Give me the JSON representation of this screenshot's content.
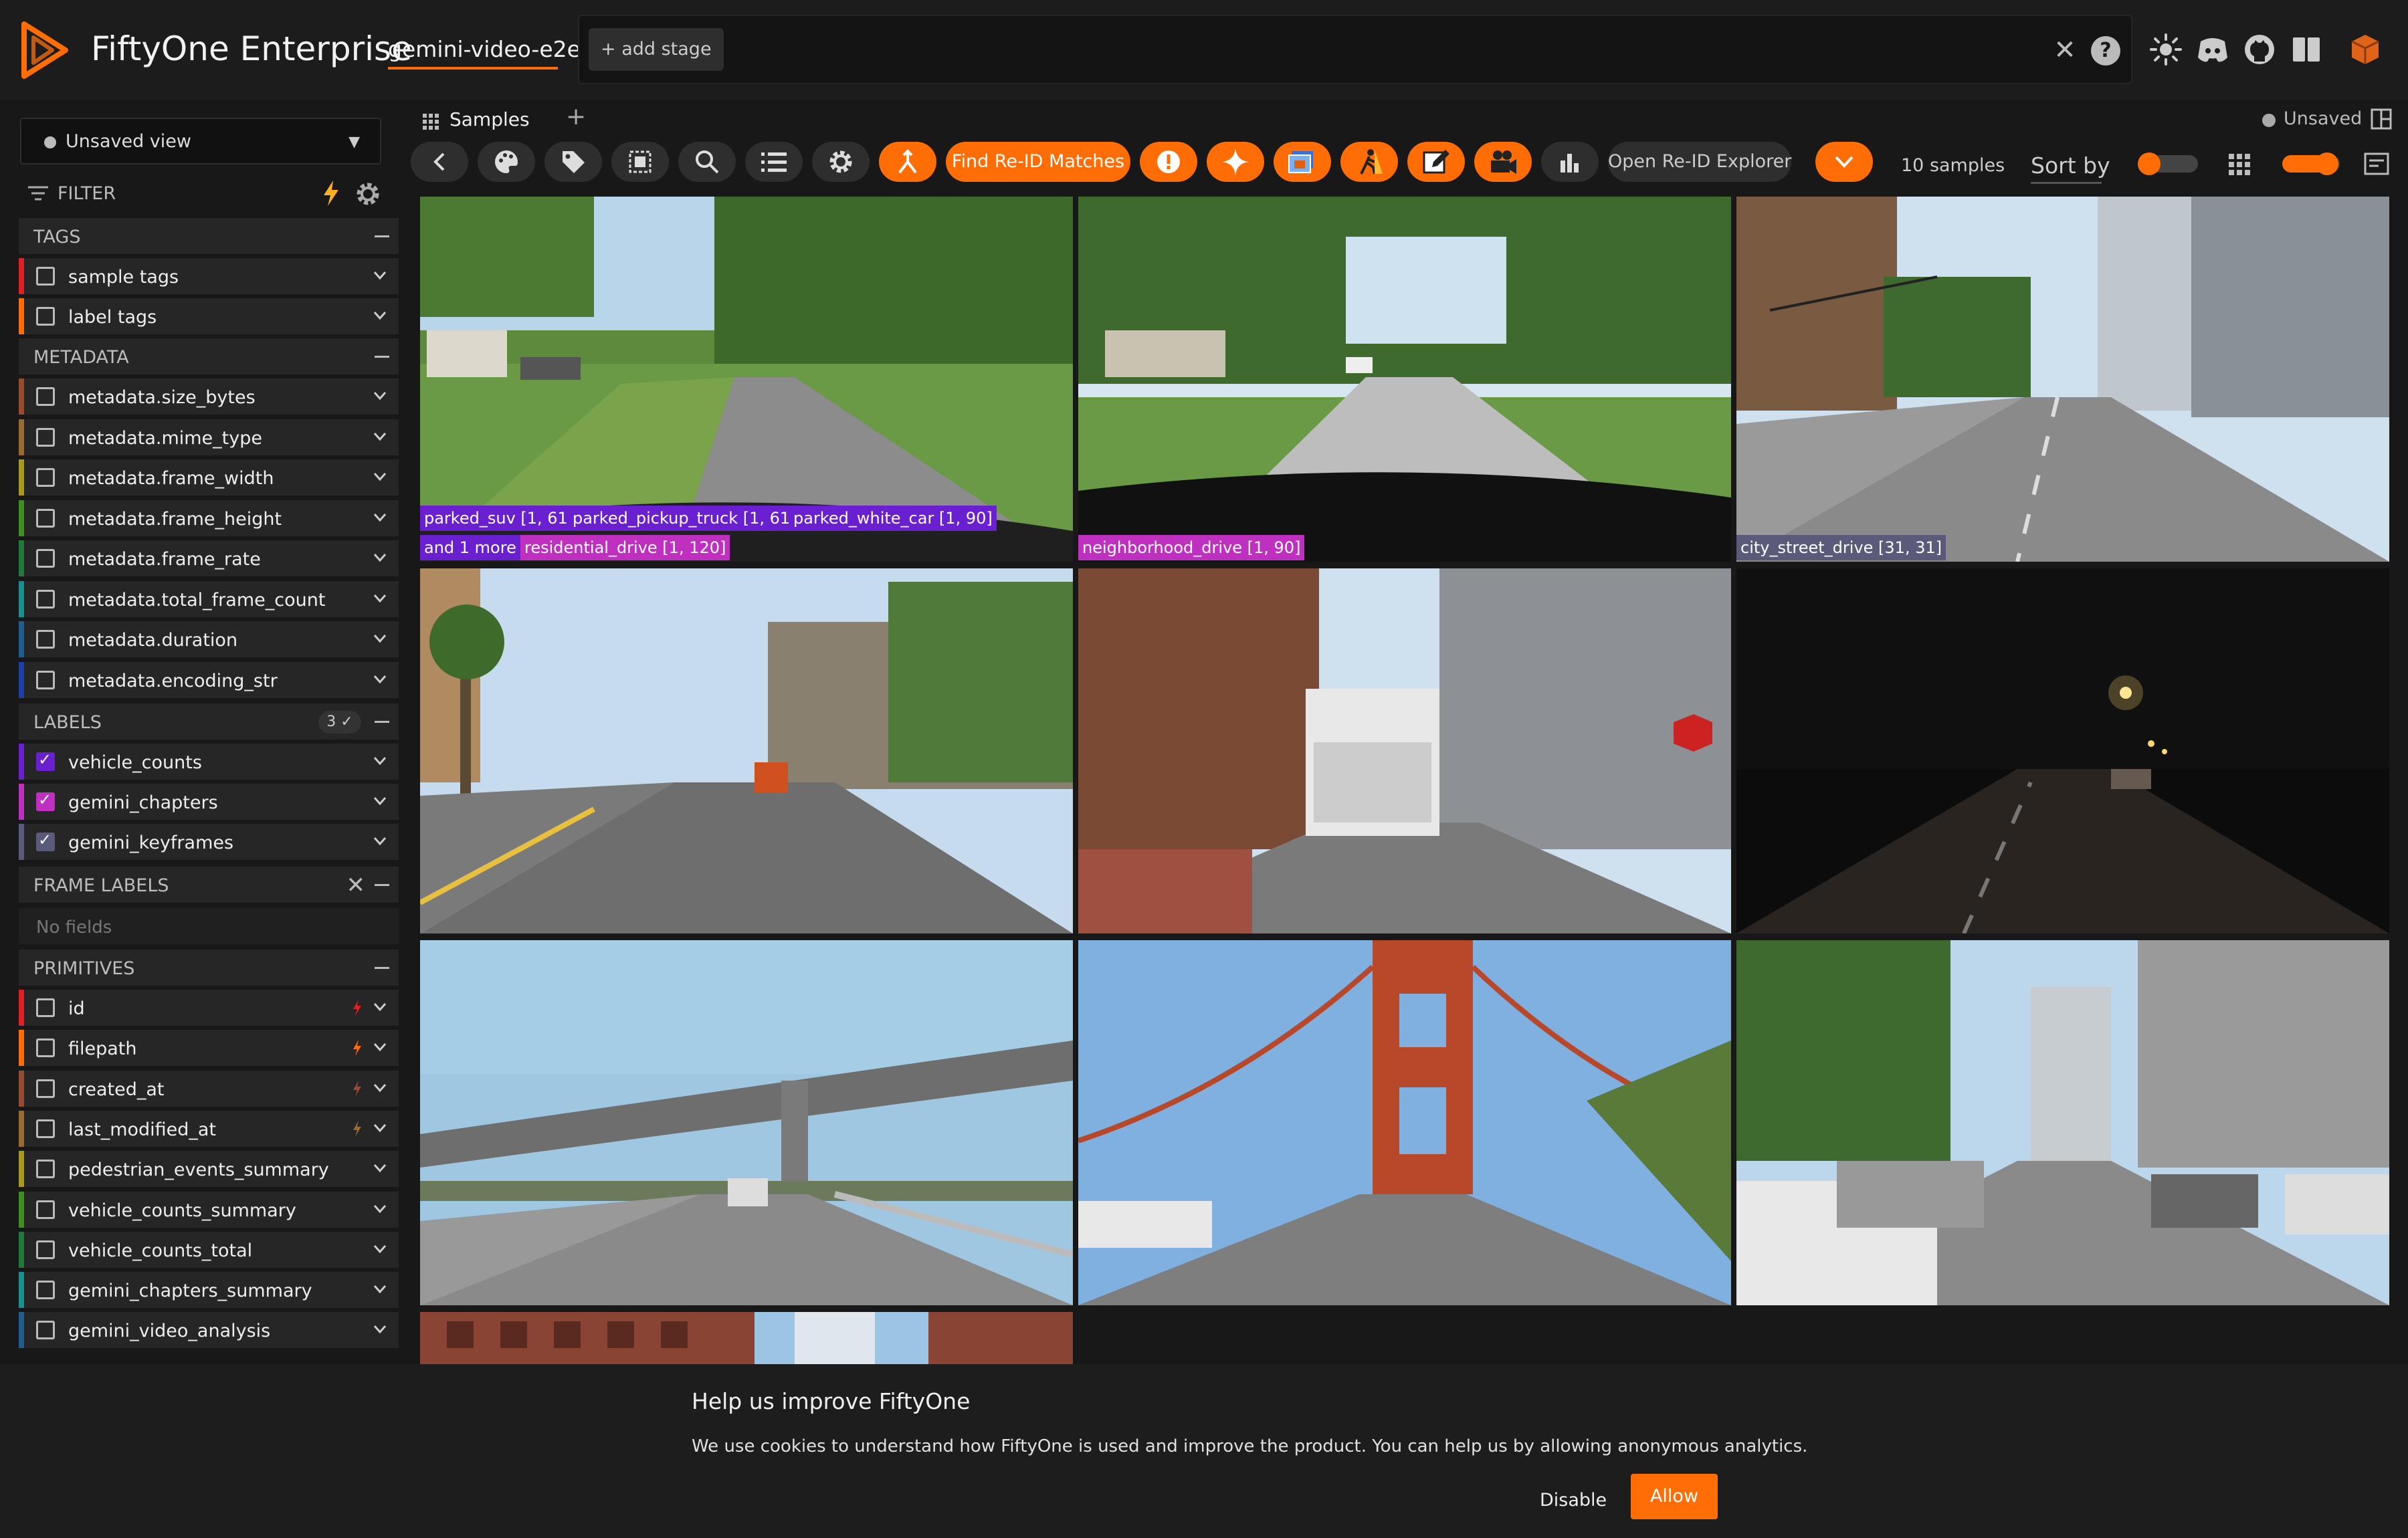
{
  "header": {
    "brand": "FiftyOne Enterprise",
    "dataset": "gemini-video-e2e",
    "add_stage": "+ add stage"
  },
  "sidebar": {
    "view_label": "Unsaved view",
    "filter_label": "FILTER",
    "sections": {
      "tags": "TAGS",
      "metadata": "METADATA",
      "labels": "LABELS",
      "labels_badge": "3 ✓",
      "frame_labels": "FRAME LABELS",
      "frame_labels_empty": "No fields",
      "primitives": "PRIMITIVES"
    },
    "tags": [
      {
        "label": "sample tags",
        "color": "#e31e24"
      },
      {
        "label": "label tags",
        "color": "#ff6d04"
      }
    ],
    "metadata": [
      {
        "label": "metadata.size_bytes",
        "color": "#9a4a2f"
      },
      {
        "label": "metadata.mime_type",
        "color": "#9a6a2f"
      },
      {
        "label": "metadata.frame_width",
        "color": "#a79a1c"
      },
      {
        "label": "metadata.frame_height",
        "color": "#3f8f1f"
      },
      {
        "label": "metadata.frame_rate",
        "color": "#1f7a3a"
      },
      {
        "label": "metadata.total_frame_count",
        "color": "#1a8f8f"
      },
      {
        "label": "metadata.duration",
        "color": "#1f5f8f"
      },
      {
        "label": "metadata.encoding_str",
        "color": "#1f3fa8"
      }
    ],
    "labels": [
      {
        "label": "vehicle_counts",
        "color": "#6a1fd1",
        "checked": true
      },
      {
        "label": "gemini_chapters",
        "color": "#c030c0",
        "checked": true
      },
      {
        "label": "gemini_keyframes",
        "color": "#5a5a7a",
        "checked": true
      }
    ],
    "primitives": [
      {
        "label": "id",
        "color": "#e31e24",
        "bolt": true
      },
      {
        "label": "filepath",
        "color": "#ff6d04",
        "bolt": true
      },
      {
        "label": "created_at",
        "color": "#9a4a2f",
        "bolt": true
      },
      {
        "label": "last_modified_at",
        "color": "#9a6a2f",
        "bolt": true
      },
      {
        "label": "pedestrian_events_summary",
        "color": "#a79a1c",
        "bolt": false
      },
      {
        "label": "vehicle_counts_summary",
        "color": "#3f8f1f",
        "bolt": false
      },
      {
        "label": "vehicle_counts_total",
        "color": "#1f7a3a",
        "bolt": false
      },
      {
        "label": "gemini_chapters_summary",
        "color": "#1a8f8f",
        "bolt": false
      },
      {
        "label": "gemini_video_analysis",
        "color": "#1f5f8f",
        "bolt": false
      }
    ]
  },
  "tabs": {
    "samples": "Samples",
    "unsaved": "Unsaved"
  },
  "toolbar": {
    "find_reid": "Find Re-ID Matches",
    "open_reid": "Open Re-ID Explorer",
    "sample_count": "10 samples",
    "sort_by": "Sort by"
  },
  "grid": {
    "tags": [
      {
        "text": "parked_suv [1, 61]",
        "color": "#6a1fd1"
      },
      {
        "text": "parked_pickup_truck [1, 61]",
        "color": "#6a1fd1"
      },
      {
        "text": "parked_white_car [1, 90]",
        "color": "#6a1fd1"
      },
      {
        "text": "and 1 more",
        "color": "#6a1fd1"
      },
      {
        "text": "residential_drive [1, 120]",
        "color": "#c030c0"
      },
      {
        "text": "neighborhood_drive [1, 90]",
        "color": "#c030c0"
      },
      {
        "text": "city_street_drive [31, 31]",
        "color": "#5a5a7a"
      }
    ]
  },
  "cookie": {
    "title": "Help us improve FiftyOne",
    "text": "We use cookies to understand how FiftyOne is used and improve the product. You can help us by allowing anonymous analytics.",
    "disable": "Disable",
    "allow": "Allow"
  },
  "colors": {
    "accent": "#ff6d04",
    "panel": "#262626",
    "background": "#181818"
  }
}
